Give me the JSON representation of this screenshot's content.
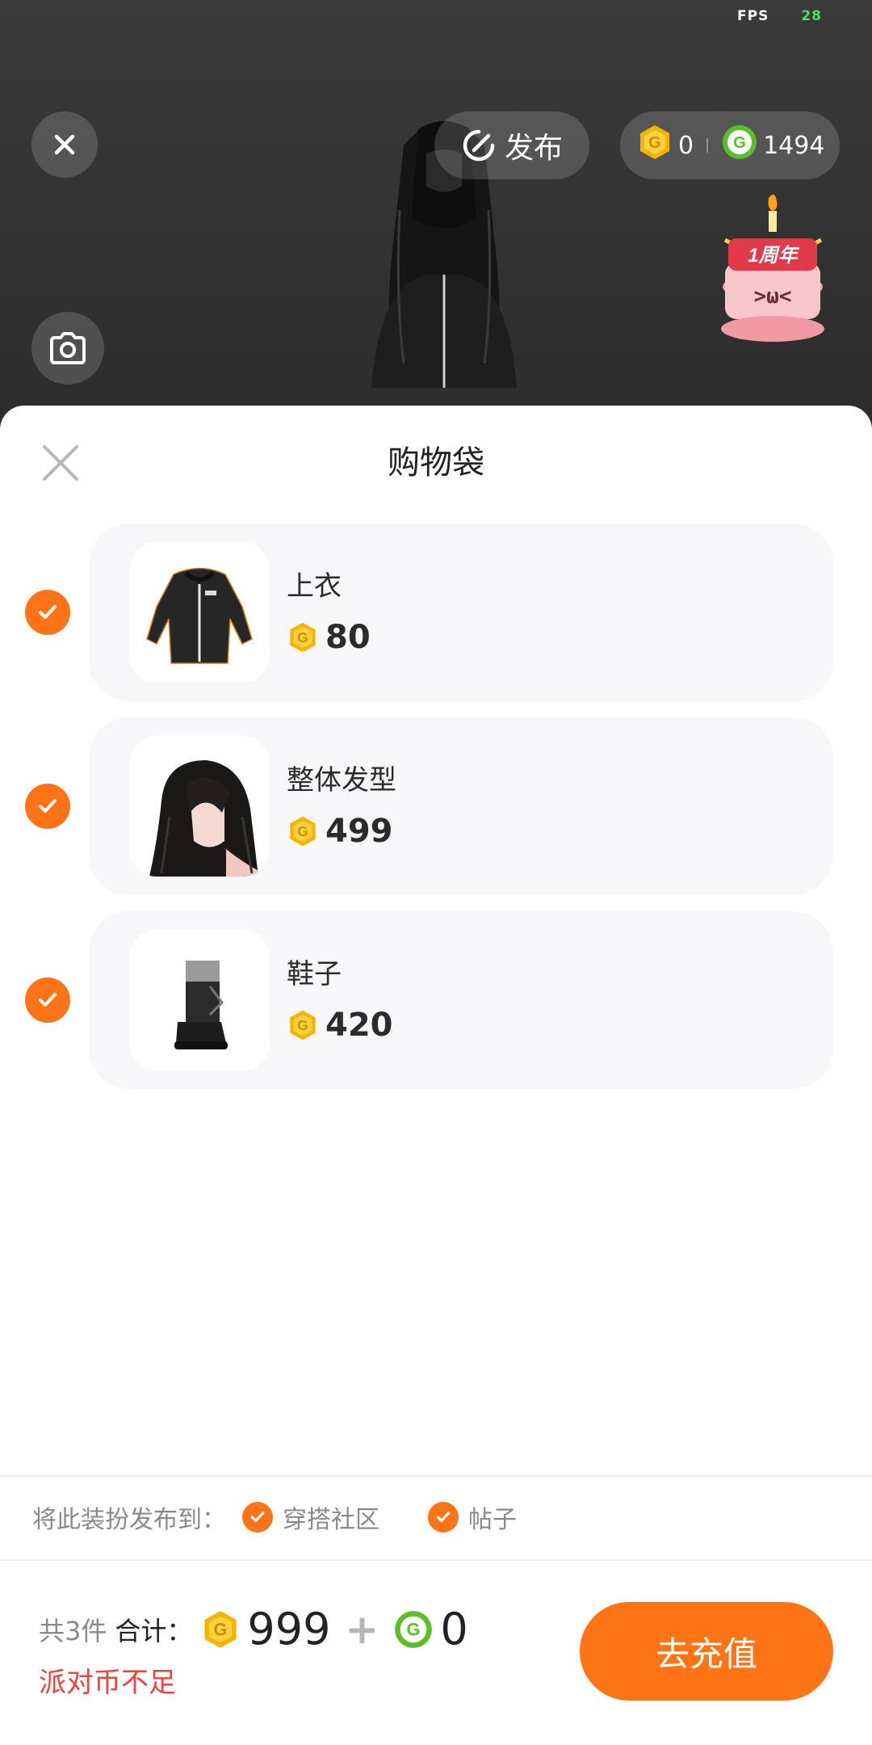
{
  "status": {
    "fps_label": "FPS",
    "fps_value": "28"
  },
  "scene": {
    "publish_label": "发布",
    "wallet": {
      "party_coins": "0",
      "green_coins": "1494"
    },
    "anniversary_badge": "1周年"
  },
  "sheet": {
    "title": "购物袋",
    "items": [
      {
        "name": "上衣",
        "price": "80",
        "checked": true,
        "image": "black-hoodie-dress"
      },
      {
        "name": "整体发型",
        "price": "499",
        "checked": true,
        "image": "long-black-hair"
      },
      {
        "name": "鞋子",
        "price": "420",
        "checked": true,
        "image": "black-boots"
      }
    ]
  },
  "publish_to": {
    "label": "将此装扮发布到：",
    "options": [
      {
        "label": "穿搭社区",
        "checked": true
      },
      {
        "label": "帖子",
        "checked": true
      }
    ]
  },
  "footer": {
    "count": "共3件",
    "total_label": "合计：",
    "party_total": "999",
    "plus": "+",
    "green_total": "0",
    "warning": "派对币不足",
    "recharge_label": "去充值"
  },
  "colors": {
    "accent": "#ff7417",
    "gold_coin": "#f5b400",
    "green_coin": "#5cbf2a",
    "warning": "#f0413b"
  }
}
